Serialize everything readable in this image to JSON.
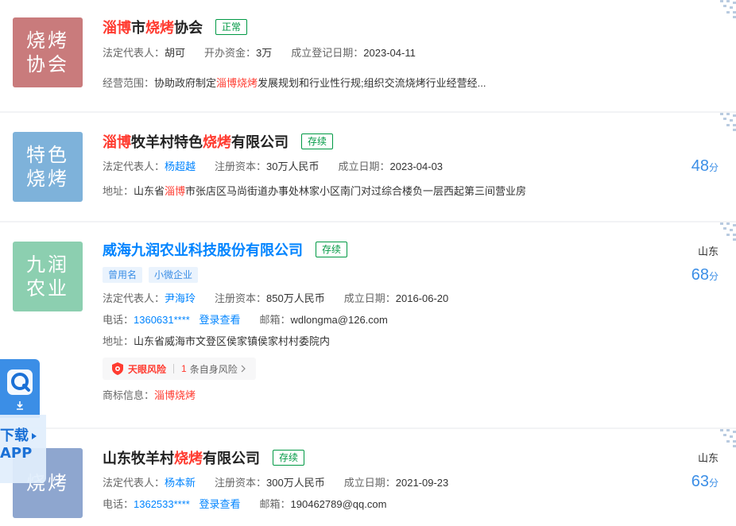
{
  "cards": [
    {
      "logo_lines": [
        "烧烤",
        "协会"
      ],
      "logo_color": "#c97b7c",
      "title_parts": [
        {
          "t": "淄博",
          "hl": true
        },
        {
          "t": "市",
          "hl": false
        },
        {
          "t": "烧烤",
          "hl": true
        },
        {
          "t": "协会",
          "hl": false
        }
      ],
      "status": "正常",
      "legal_label": "法定代表人：",
      "legal_name": "胡可",
      "capital_label": "开办资金：",
      "capital": "3万",
      "date_label": "成立登记日期：",
      "date": "2023-04-11",
      "scope_label": "经营范围：",
      "scope_parts": [
        {
          "t": "协助政府制定",
          "hl": false
        },
        {
          "t": "淄博烧烤",
          "hl": true
        },
        {
          "t": "发展规划和行业性行规;组织交流烧烤行业经营经...",
          "hl": false
        }
      ]
    },
    {
      "logo_lines": [
        "特色",
        "烧烤"
      ],
      "logo_color": "#7eb2da",
      "title_parts": [
        {
          "t": "淄博",
          "hl": true
        },
        {
          "t": "牧羊村特色",
          "hl": false
        },
        {
          "t": "烧烤",
          "hl": true
        },
        {
          "t": "有限公司",
          "hl": false
        }
      ],
      "status": "存续",
      "legal_label": "法定代表人：",
      "legal_name": "杨超越",
      "capital_label": "注册资本：",
      "capital": "30万人民币",
      "date_label": "成立日期：",
      "date": "2023-04-03",
      "address_label": "地址：",
      "address_parts": [
        {
          "t": "山东省",
          "hl": false
        },
        {
          "t": "淄博",
          "hl": true
        },
        {
          "t": "市张店区马尚街道办事处林家小区南门对过综合楼负一层西起第三间营业房",
          "hl": false
        }
      ],
      "score": "48",
      "score_unit": "分"
    },
    {
      "logo_lines": [
        "九润",
        "农业"
      ],
      "logo_color": "#8ccfb0",
      "title": "威海九润农业科技股份有限公司",
      "status": "存续",
      "tags": [
        "曾用名",
        "小微企业"
      ],
      "legal_label": "法定代表人：",
      "legal_name": "尹海玲",
      "capital_label": "注册资本：",
      "capital": "850万人民币",
      "date_label": "成立日期：",
      "date": "2016-06-20",
      "phone_label": "电话：",
      "phone": "1360631****",
      "login_view": "登录查看",
      "email_label": "邮箱：",
      "email": "wdlongma@126.com",
      "address_label": "地址：",
      "address": "山东省威海市文登区侯家镇侯家村村委院内",
      "risk_brand": "天眼风险",
      "risk_count": "1",
      "risk_text": "条自身风险",
      "trademark_label": "商标信息：",
      "trademark": "淄博烧烤",
      "region": "山东",
      "score": "68",
      "score_unit": "分"
    },
    {
      "logo_lines": [
        "烧烤"
      ],
      "logo_color": "#8ea6cf",
      "title_parts": [
        {
          "t": "山东牧羊村",
          "hl": false
        },
        {
          "t": "烧烤",
          "hl": true
        },
        {
          "t": "有限公司",
          "hl": false
        }
      ],
      "status": "存续",
      "legal_label": "法定代表人：",
      "legal_name": "杨本新",
      "capital_label": "注册资本：",
      "capital": "300万人民币",
      "date_label": "成立日期：",
      "date": "2021-09-23",
      "phone_label": "电话：",
      "phone": "1362533****",
      "login_view": "登录查看",
      "email_label": "邮箱：",
      "email": "190462789@qq.com",
      "region": "山东",
      "score": "63",
      "score_unit": "分"
    }
  ],
  "float_app": {
    "line1": "下载",
    "line2": "APP"
  },
  "colors": {
    "brand_blue": "#0084ff",
    "highlight_red": "#ff3b30",
    "status_green": "#009944"
  }
}
